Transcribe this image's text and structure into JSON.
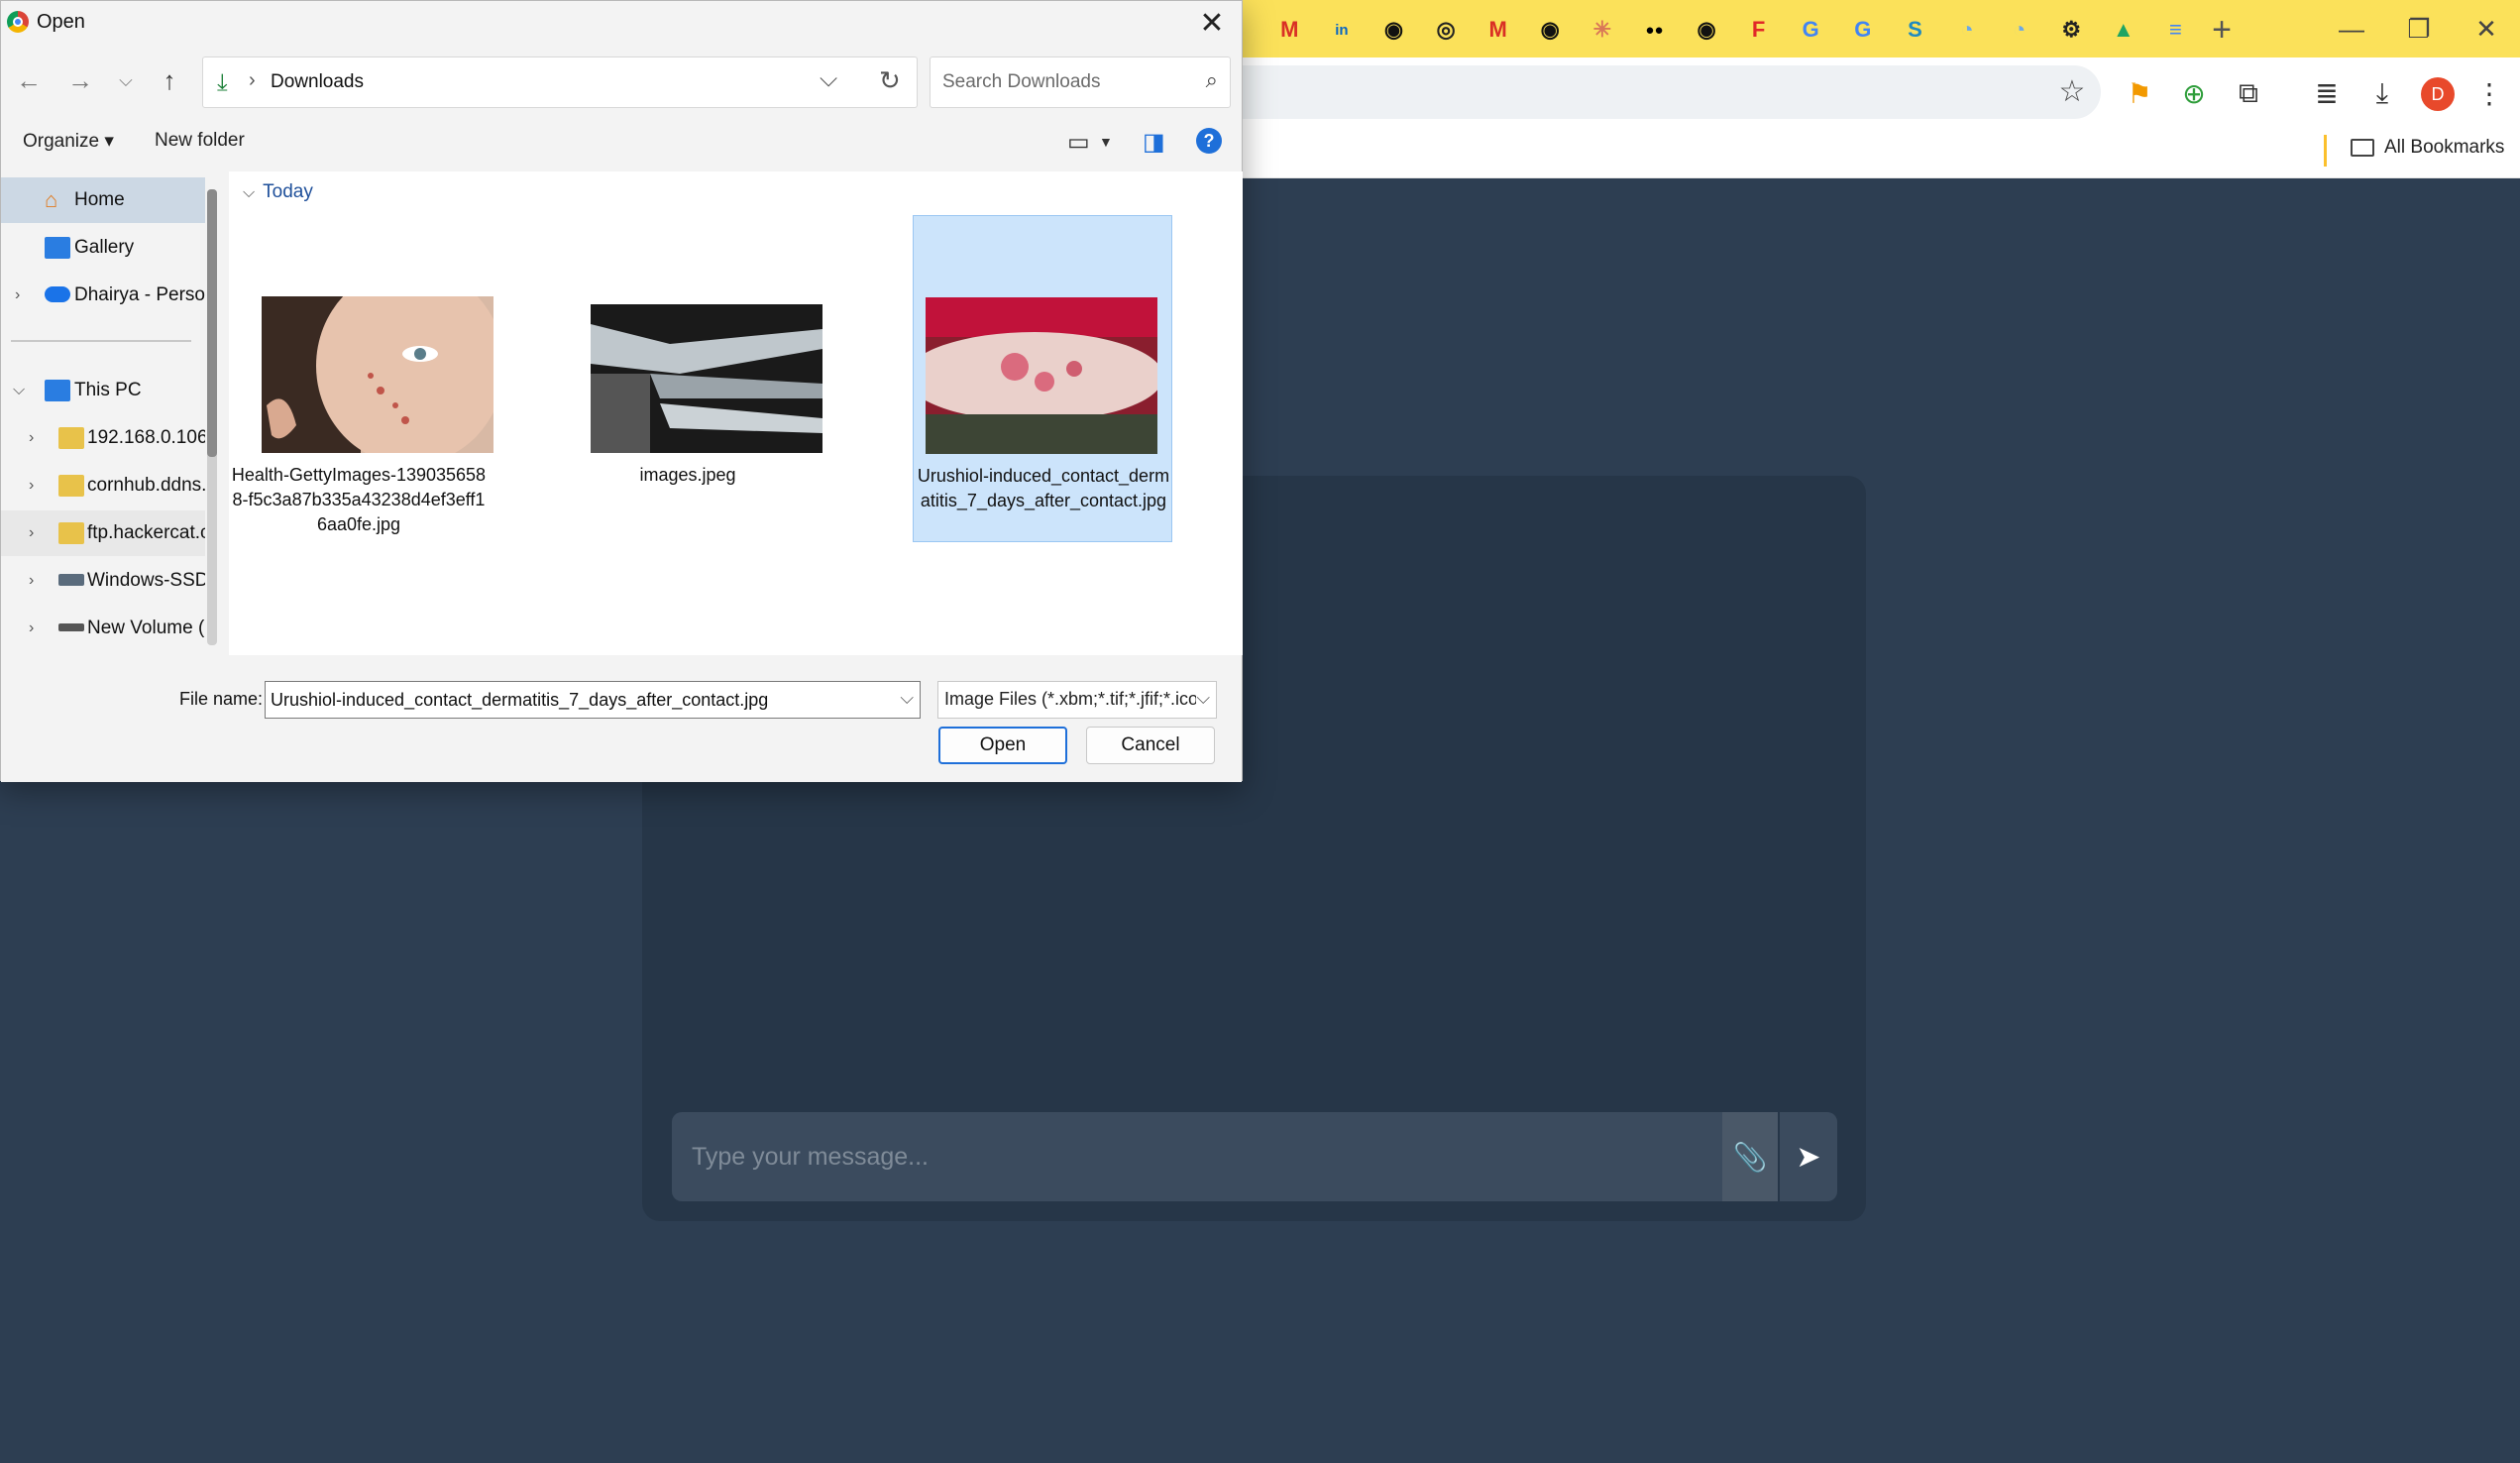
{
  "browser": {
    "tab_icons": [
      {
        "icon": "gmail-icon",
        "glyph": "M",
        "color": "#d93025"
      },
      {
        "icon": "linkedin-icon",
        "glyph": "in",
        "color": "#0a66c2"
      },
      {
        "icon": "github-icon",
        "glyph": "◉",
        "color": "#111111"
      },
      {
        "icon": "chrome-icon",
        "glyph": "◎",
        "color": "#222222"
      },
      {
        "icon": "gmail-icon",
        "glyph": "M",
        "color": "#d93025"
      },
      {
        "icon": "github-icon",
        "glyph": "◉",
        "color": "#111111"
      },
      {
        "icon": "claude-icon",
        "glyph": "✳",
        "color": "#d97757"
      },
      {
        "icon": "medium-icon",
        "glyph": "●●",
        "color": "#000000"
      },
      {
        "icon": "github-icon",
        "glyph": "◉",
        "color": "#111111"
      },
      {
        "icon": "flipboard-icon",
        "glyph": "F",
        "color": "#e12828"
      },
      {
        "icon": "google-icon",
        "glyph": "G",
        "color": "#4285f4"
      },
      {
        "icon": "google-icon",
        "glyph": "G",
        "color": "#4285f4"
      },
      {
        "icon": "skype-icon",
        "glyph": "S",
        "color": "#1f8ac0"
      },
      {
        "icon": "timer-icon",
        "glyph": "◔",
        "color": "#6aa8e8"
      },
      {
        "icon": "timer-icon",
        "glyph": "◔",
        "color": "#6aa8e8"
      },
      {
        "icon": "openai-icon",
        "glyph": "⚙",
        "color": "#222222"
      },
      {
        "icon": "drive-icon",
        "glyph": "▲",
        "color": "#1fa463"
      },
      {
        "icon": "docs-icon",
        "glyph": "≡",
        "color": "#4285f4"
      }
    ],
    "new_tab": "+",
    "avatar_letter": "D",
    "all_bookmarks": "All Bookmarks",
    "accent": "#fbe15a"
  },
  "chat": {
    "placeholder": "Type your message..."
  },
  "dialog": {
    "title": "Open",
    "path": "Downloads",
    "search_placeholder": "Search Downloads",
    "organize": "Organize ▾",
    "new_folder": "New folder",
    "nav": {
      "home": "Home",
      "gallery": "Gallery",
      "onedrive": "Dhairya - Personal",
      "this_pc": "This PC",
      "net1": "192.168.0.106",
      "net2": "cornhub.ddns.net",
      "net3": "ftp.hackercat.com",
      "drive_c": "Windows-SSD (C:)",
      "drive_d": "New Volume (D:)"
    },
    "group": "Today",
    "files": [
      {
        "name": "Health-GettyImages-1390356588-f5c3a87b335a43238d4ef3eff16aa0fe.jpg",
        "thumb": "acne-face-photo",
        "selected": false
      },
      {
        "name": "images.jpeg",
        "thumb": "hand-xray",
        "selected": false
      },
      {
        "name": "Urushiol-induced_contact_dermatitis_7_days_after_contact.jpg",
        "thumb": "arm-rash-photo",
        "selected": true
      }
    ],
    "file_name_label": "File name:",
    "file_name_value": "Urushiol-induced_contact_dermatitis_7_days_after_contact.jpg",
    "file_type": "Image Files (*.xbm;*.tif;*.jfif;*.ico",
    "open_label": "Open",
    "cancel_label": "Cancel"
  }
}
